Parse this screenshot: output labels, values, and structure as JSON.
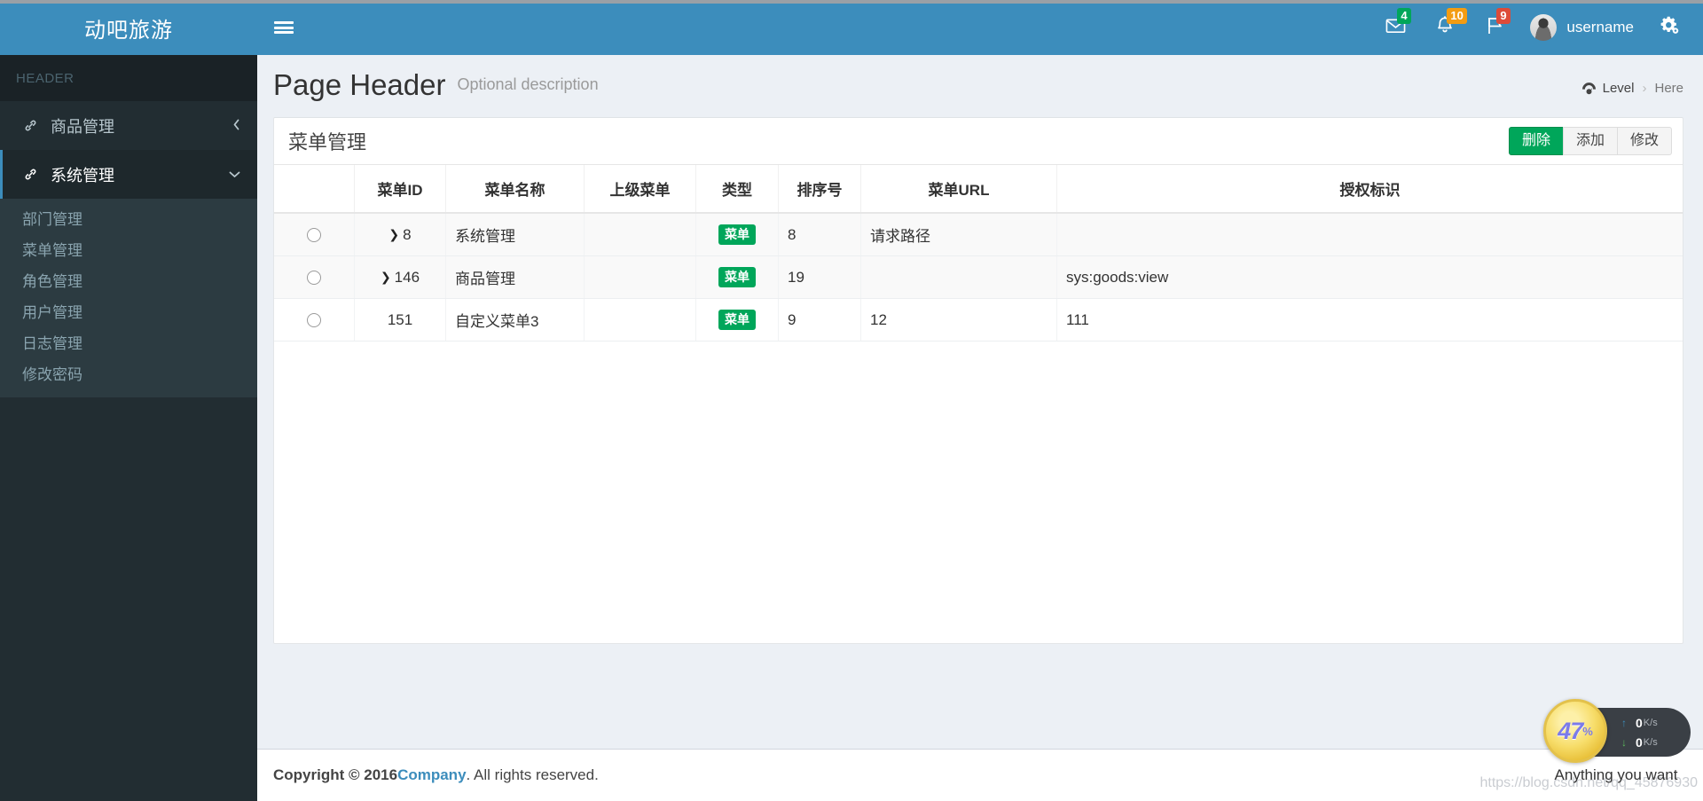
{
  "brand": {
    "title": "动吧旅游"
  },
  "sidebar": {
    "header_label": "HEADER",
    "items": [
      {
        "label": "商品管理",
        "icon": "link-icon",
        "arrow": "‹",
        "active": false
      },
      {
        "label": "系统管理",
        "icon": "link-icon",
        "arrow": "⌵",
        "active": true
      }
    ],
    "submenu": [
      {
        "label": "部门管理"
      },
      {
        "label": "菜单管理"
      },
      {
        "label": "角色管理"
      },
      {
        "label": "用户管理"
      },
      {
        "label": "日志管理"
      },
      {
        "label": "修改密码"
      }
    ]
  },
  "topbar": {
    "menu_toggle": "hamburger-icon",
    "messages": {
      "icon": "envelope-icon",
      "count": "4",
      "color": "#00a65a"
    },
    "notifications": {
      "icon": "bell-icon",
      "count": "10",
      "color": "#f39c12"
    },
    "tasks": {
      "icon": "flag-icon",
      "count": "9",
      "color": "#dd4b39"
    },
    "user": {
      "name": "username",
      "avatar": "avatar"
    },
    "settings_icon": "gears-icon"
  },
  "page": {
    "title": "Page Header",
    "description": "Optional description",
    "breadcrumb": {
      "icon": "dashboard-icon",
      "level": "Level",
      "separator": "›",
      "here": "Here"
    }
  },
  "panel": {
    "title": "菜单管理",
    "buttons": [
      {
        "label": "删除",
        "style": "primary"
      },
      {
        "label": "添加",
        "style": "default"
      },
      {
        "label": "修改",
        "style": "default"
      }
    ],
    "table": {
      "columns": [
        "",
        "菜单ID",
        "菜单名称",
        "上级菜单",
        "类型",
        "排序号",
        "菜单URL",
        "授权标识"
      ],
      "rows": [
        {
          "select": "radio",
          "expandable": true,
          "id": "8",
          "name": "系统管理",
          "parent": "",
          "type": "菜单",
          "sort": "8",
          "url": "请求路径",
          "perm": ""
        },
        {
          "select": "radio",
          "expandable": true,
          "id": "146",
          "name": "商品管理",
          "parent": "",
          "type": "菜单",
          "sort": "19",
          "url": "",
          "perm": "sys:goods:view"
        },
        {
          "select": "radio",
          "expandable": false,
          "id": "151",
          "name": "自定义菜单3",
          "parent": "",
          "type": "菜单",
          "sort": "9",
          "url": "12",
          "perm": "111"
        }
      ]
    }
  },
  "footer": {
    "copyright_prefix": "Copyright © 2016 ",
    "company": "Company",
    "copyright_suffix": ". All rights reserved."
  },
  "float_widget": {
    "percent": "47",
    "percent_unit": "%",
    "upload": {
      "value": "0",
      "unit": "K/s",
      "arrow": "↑"
    },
    "download": {
      "value": "0",
      "unit": "K/s",
      "arrow": "↓"
    },
    "caption": "Anything you want"
  },
  "watermark": "https://blog.csdn.net/qq_45876930",
  "colors": {
    "brand_blue": "#3c8dbc",
    "sidebar_dark": "#222d32",
    "submenu_bg": "#2c3b41",
    "success_green": "#00a65a",
    "content_bg": "#ecf0f5"
  }
}
